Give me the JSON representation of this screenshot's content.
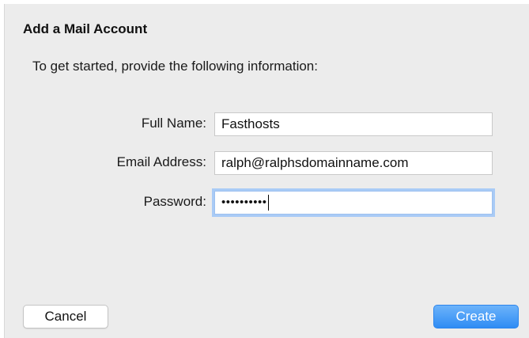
{
  "dialog": {
    "title": "Add a Mail Account",
    "intro": "To get started, provide the following information:"
  },
  "form": {
    "full_name": {
      "label": "Full Name:",
      "value": "Fasthosts"
    },
    "email": {
      "label": "Email Address:",
      "value": "ralph@ralphsdomainname.com"
    },
    "password": {
      "label": "Password:",
      "masked_value": "••••••••••",
      "focused": true
    }
  },
  "buttons": {
    "cancel_label": "Cancel",
    "create_label": "Create"
  },
  "colors": {
    "background": "#ececec",
    "accent": "#2f8cf4",
    "focus_ring": "#a9cbf6"
  }
}
